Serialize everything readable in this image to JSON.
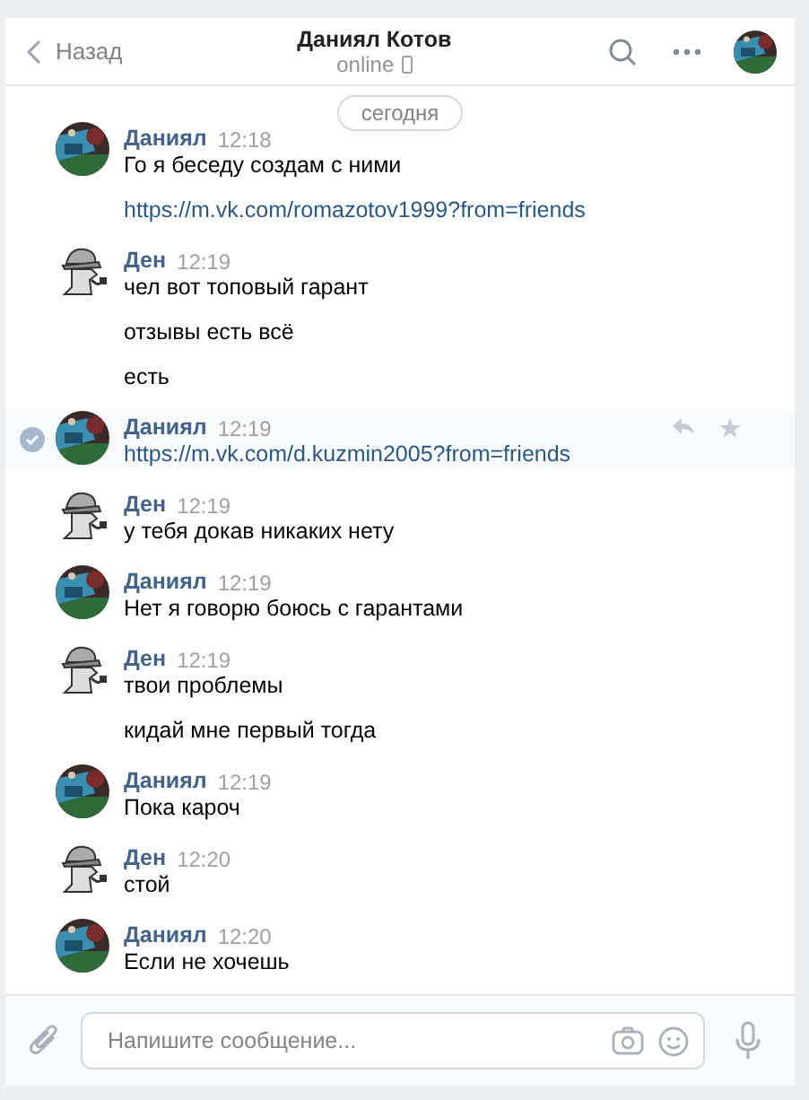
{
  "header": {
    "back": "Назад",
    "title": "Даниял Котов",
    "status": "online"
  },
  "date_divider": "сегодня",
  "messages": [
    {
      "author": "Даниял",
      "time": "12:18",
      "selected": false,
      "lines": [
        {
          "kind": "text",
          "text": "Го я беседу создам с ними"
        },
        {
          "kind": "link",
          "text": "https://m.vk.com/romazotov1999?from=friends"
        }
      ]
    },
    {
      "author": "Ден",
      "kind": "detective",
      "time": "12:19",
      "selected": false,
      "lines": [
        {
          "kind": "text",
          "text": "чел вот топовый гарант"
        },
        {
          "kind": "text",
          "text": "отзывы есть всё"
        },
        {
          "kind": "text",
          "text": "есть"
        }
      ]
    },
    {
      "author": "Даниял",
      "time": "12:19",
      "selected": true,
      "lines": [
        {
          "kind": "link",
          "text": "https://m.vk.com/d.kuzmin2005?from=friends"
        }
      ]
    },
    {
      "author": "Ден",
      "kind": "detective",
      "time": "12:19",
      "selected": false,
      "lines": [
        {
          "kind": "text",
          "text": "у тебя докав никаких нету"
        }
      ]
    },
    {
      "author": "Даниял",
      "time": "12:19",
      "selected": false,
      "lines": [
        {
          "kind": "text",
          "text": "Нет я говорю боюсь с гарантами"
        }
      ]
    },
    {
      "author": "Ден",
      "kind": "detective",
      "time": "12:19",
      "selected": false,
      "lines": [
        {
          "kind": "text",
          "text": "твои проблемы"
        },
        {
          "kind": "text",
          "text": "кидай мне первый тогда"
        }
      ]
    },
    {
      "author": "Даниял",
      "time": "12:19",
      "selected": false,
      "lines": [
        {
          "kind": "text",
          "text": "Пока кароч"
        }
      ]
    },
    {
      "author": "Ден",
      "kind": "detective",
      "time": "12:20",
      "selected": false,
      "lines": [
        {
          "kind": "text",
          "text": "стой"
        }
      ]
    },
    {
      "author": "Даниял",
      "time": "12:20",
      "selected": false,
      "lines": [
        {
          "kind": "text",
          "text": "Если не хочешь"
        }
      ]
    }
  ],
  "composer": {
    "placeholder": "Напишите сообщение..."
  }
}
